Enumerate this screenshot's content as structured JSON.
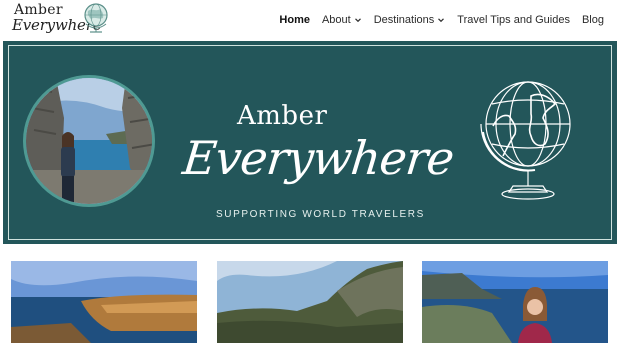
{
  "logo": {
    "line1": "Amber",
    "line2": "Everywhere"
  },
  "nav": {
    "home": "Home",
    "about": "About",
    "destinations": "Destinations",
    "travel_tips": "Travel Tips and Guides",
    "blog": "Blog"
  },
  "hero": {
    "title_line1": "Amber",
    "title_line2": "Everywhere",
    "tagline": "SUPPORTING WORLD TRAVELERS"
  },
  "colors": {
    "hero_bg": "#23565a",
    "accent": "#4f9a93",
    "frame": "#cfe2de"
  },
  "icons": [
    "globe-icon",
    "chevron-down-icon"
  ]
}
